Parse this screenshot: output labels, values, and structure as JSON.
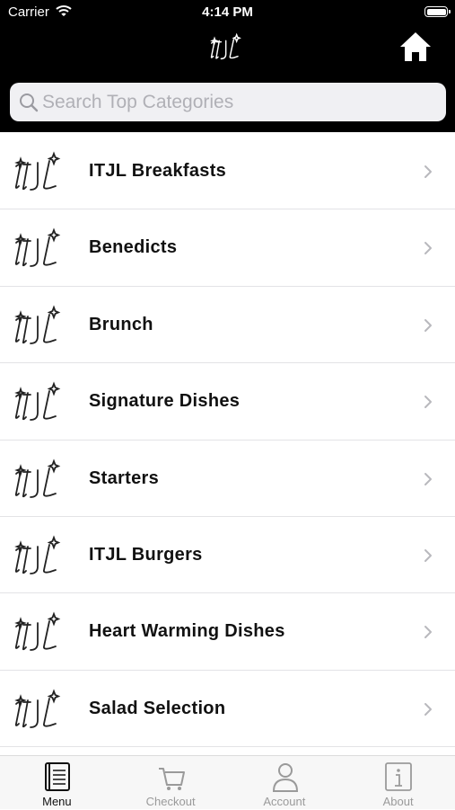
{
  "status_bar": {
    "carrier": "Carrier",
    "time": "4:14 PM"
  },
  "header": {
    "logo_icon": "itjl-logo",
    "home_icon": "home-icon"
  },
  "search": {
    "placeholder": "Search Top Categories",
    "value": ""
  },
  "categories": [
    {
      "label": "ITJL Breakfasts"
    },
    {
      "label": "Benedicts"
    },
    {
      "label": "Brunch"
    },
    {
      "label": "Signature Dishes"
    },
    {
      "label": "Starters"
    },
    {
      "label": "ITJL Burgers"
    },
    {
      "label": "Heart Warming Dishes"
    },
    {
      "label": "Salad Selection"
    }
  ],
  "tabs": [
    {
      "label": "Menu",
      "icon": "menu-book-icon",
      "active": true
    },
    {
      "label": "Checkout",
      "icon": "cart-icon",
      "active": false
    },
    {
      "label": "Account",
      "icon": "person-icon",
      "active": false
    },
    {
      "label": "About",
      "icon": "info-icon",
      "active": false
    }
  ],
  "colors": {
    "header_bg": "#000000",
    "tab_active": "#111111",
    "tab_inactive": "#9a9a9a"
  }
}
